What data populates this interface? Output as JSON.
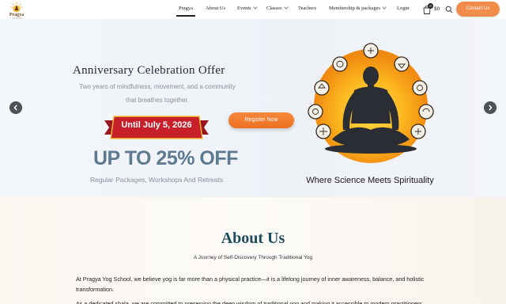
{
  "logo": {
    "wordmark": "Pragya",
    "tagline": "Yog School"
  },
  "nav": {
    "items": [
      {
        "label": "Pragya",
        "active": true,
        "dropdown": false
      },
      {
        "label": "About Us",
        "active": false,
        "dropdown": false
      },
      {
        "label": "Events",
        "active": false,
        "dropdown": true
      },
      {
        "label": "Classes",
        "active": false,
        "dropdown": true
      },
      {
        "label": "Teachers",
        "active": false,
        "dropdown": false
      },
      {
        "label": "Membership & packages",
        "active": false,
        "dropdown": true
      },
      {
        "label": "Login",
        "active": false,
        "dropdown": false
      }
    ],
    "cart_count": "0",
    "cart_total": "$0",
    "contact_label": "Contact Us"
  },
  "hero": {
    "title": "Anniversary Celebration Offer",
    "subtitle_line1": "Two years of mindfulness, movement, and a community",
    "subtitle_line2": "that breathes together.",
    "ribbon_text": "Until July 5, 2026",
    "promo": "UP TO 25% OFF",
    "promo_sub": "Regular Packages, Workshops And Retreats",
    "cta_label": "Register Now",
    "caption": "Where Science Meets Spirituality"
  },
  "about": {
    "title": "About Us",
    "subtitle": "A Journey of Self-Discovery Through Traditional Yog",
    "paragraph1_line1": "At Pragya Yog School, we believe yog is far more than a physical practice—it is a lifelong journey of inner awareness, balance, and holistic",
    "paragraph1_line2": "transformation.",
    "paragraph2": "As a dedicated shala, we are committed to preserving the deep wisdom of traditional yog and making it accessible to modern practitioners"
  },
  "colors": {
    "accent": "#f28c4a",
    "cta": "#ee6f22",
    "ribbon": "#c8202a",
    "promo": "#5e7a90",
    "heading": "#1e4d5e"
  }
}
